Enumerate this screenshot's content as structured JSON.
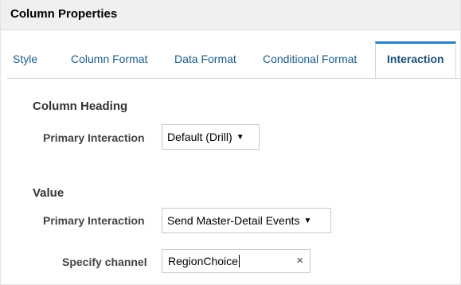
{
  "dialog": {
    "title": "Column Properties"
  },
  "tabs": [
    {
      "label": "Style"
    },
    {
      "label": "Column Format"
    },
    {
      "label": "Data Format"
    },
    {
      "label": "Conditional Format"
    },
    {
      "label": "Interaction",
      "active": true
    }
  ],
  "column_heading": {
    "heading": "Column Heading",
    "primary_interaction_label": "Primary Interaction",
    "primary_interaction_value": "Default (Drill)"
  },
  "value": {
    "heading": "Value",
    "primary_interaction_label": "Primary Interaction",
    "primary_interaction_value": "Send Master-Detail Events",
    "specify_channel_label": "Specify channel",
    "specify_channel_value": "RegionChoice",
    "clear_symbol": "×"
  },
  "icons": {
    "dropdown": "triangle-down-icon",
    "clear": "close-icon"
  },
  "colors": {
    "active_tab_accent": "#2f7fc1",
    "tab_text": "#1a5c8a"
  }
}
